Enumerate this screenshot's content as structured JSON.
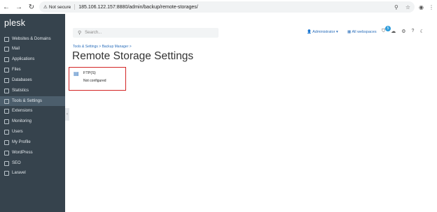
{
  "browser": {
    "security_label": "Not secure",
    "url": "185.106.122.157:8880/admin/backup/remote-storages/"
  },
  "sidebar": {
    "logo": "plesk",
    "items": [
      {
        "label": "Websites & Domains",
        "icon": "globe-icon",
        "active": false
      },
      {
        "label": "Mail",
        "icon": "mail-icon",
        "active": false
      },
      {
        "label": "Applications",
        "icon": "apps-icon",
        "active": false
      },
      {
        "label": "Files",
        "icon": "folder-icon",
        "active": false
      },
      {
        "label": "Databases",
        "icon": "database-icon",
        "active": false
      },
      {
        "label": "Statistics",
        "icon": "chart-icon",
        "active": false
      },
      {
        "label": "Tools & Settings",
        "icon": "tools-icon",
        "active": true
      },
      {
        "label": "Extensions",
        "icon": "extensions-icon",
        "active": false
      },
      {
        "label": "Monitoring",
        "icon": "monitor-icon",
        "active": false
      },
      {
        "label": "Users",
        "icon": "users-icon",
        "active": false
      },
      {
        "label": "My Profile",
        "icon": "profile-icon",
        "active": false
      },
      {
        "label": "WordPress",
        "icon": "wordpress-icon",
        "active": false
      },
      {
        "label": "SEO",
        "icon": "seo-icon",
        "active": false
      },
      {
        "label": "Laravel",
        "icon": "laravel-icon",
        "active": false
      }
    ]
  },
  "header": {
    "search_placeholder": "Search...",
    "admin_label": "Administrator",
    "webspaces_label": "All webspaces",
    "notification_count": "5"
  },
  "breadcrumb": {
    "item1": "Tools & Settings",
    "sep1": ">",
    "item2": "Backup Manager",
    "sep2": ">"
  },
  "page_title": "Remote Storage Settings",
  "storage": {
    "name": "FTP(S)",
    "status": "Not configured"
  }
}
